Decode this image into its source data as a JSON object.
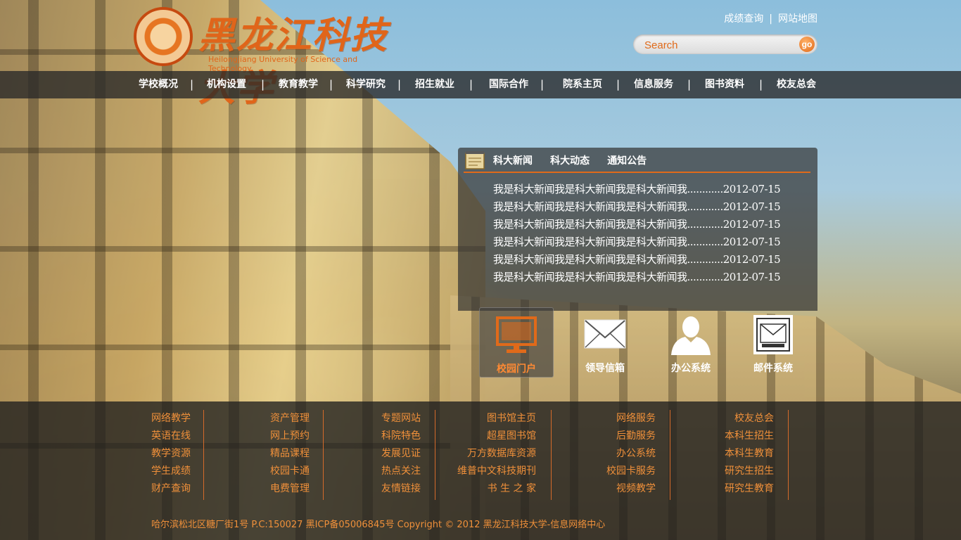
{
  "header": {
    "logo_cn": "黑龙江科技大学",
    "logo_en": "Heilongjiang University of Science and Technology",
    "top_links": [
      "成绩查询",
      "网站地图"
    ],
    "search": {
      "placeholder": "Search",
      "button": "go"
    }
  },
  "nav": {
    "items": [
      "学校概况",
      "机构设置",
      "教育教学",
      "科学研究",
      "招生就业",
      "国际合作",
      "院系主页",
      "信息服务",
      "图书资料",
      "校友总会"
    ],
    "separator": "|"
  },
  "news": {
    "tabs": [
      "科大新闻",
      "科大动态",
      "通知公告"
    ],
    "items": [
      "我是科大新闻我是科大新闻我是科大新闻我............2012-07-15",
      "我是科大新闻我是科大新闻我是科大新闻我............2012-07-15",
      "我是科大新闻我是科大新闻我是科大新闻我............2012-07-15",
      "我是科大新闻我是科大新闻我是科大新闻我............2012-07-15",
      "我是科大新闻我是科大新闻我是科大新闻我............2012-07-15",
      "我是科大新闻我是科大新闻我是科大新闻我............2012-07-15"
    ]
  },
  "quick_links": [
    {
      "label": "校园门户",
      "icon": "monitor-icon",
      "active": true
    },
    {
      "label": "领导信箱",
      "icon": "envelope-icon",
      "active": false
    },
    {
      "label": "办公系统",
      "icon": "person-icon",
      "active": false
    },
    {
      "label": "邮件系统",
      "icon": "mail-system-icon",
      "active": false
    }
  ],
  "footer": {
    "columns": [
      [
        "网络教学",
        "英语在线",
        "教学资源",
        "学生成绩",
        "财产查询"
      ],
      [
        "资产管理",
        "网上预约",
        "精品课程",
        "校园卡通",
        "电费管理"
      ],
      [
        "专题网站",
        "科院特色",
        "发展见证",
        "热点关注",
        "友情链接"
      ],
      [
        "图书馆主页",
        "超星图书馆",
        "万方数据库资源",
        "维普中文科技期刊",
        "书 生 之 家"
      ],
      [
        "网络服务",
        "后勤服务",
        "办公系统",
        "校园卡服务",
        "视频教学"
      ],
      [
        "校友总会",
        "本科生招生",
        "本科生教育",
        "研究生招生",
        "研究生教育"
      ]
    ],
    "copyright": "哈尔滨松北区糖厂街1号 P.C:150027  黑ICP备05006845号   Copyright © 2012  黑龙江科技大学-信息网络中心"
  },
  "colors": {
    "accent": "#e06a1a",
    "footer_link": "#f0903a",
    "nav_bg": "#2b2b2b"
  }
}
